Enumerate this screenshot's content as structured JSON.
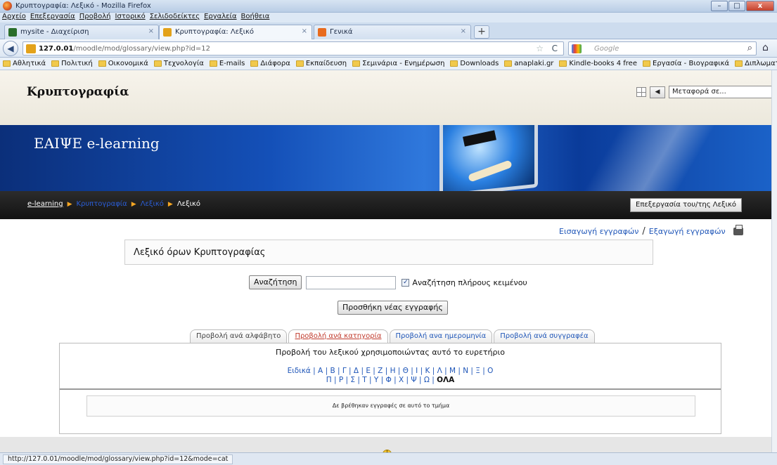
{
  "window": {
    "title": "Κρυπτογραφία: Λεξικό - Mozilla Firefox"
  },
  "menu": [
    "Αρχείο",
    "Επεξεργασία",
    "Προβολή",
    "Ιστορικό",
    "Σελιδοδείκτες",
    "Εργαλεία",
    "Βοήθεια"
  ],
  "tabs": [
    {
      "label": "mysite - Διαχείριση",
      "icon_color": "#2a6e2a"
    },
    {
      "label": "Κρυπτογραφία: Λεξικό",
      "icon_color": "#e3a21a"
    },
    {
      "label": "Γενικά",
      "icon_color": "#e86b1e"
    }
  ],
  "nav": {
    "url_host": "127.0.01",
    "url_path": "/moodle/mod/glossary/view.php?id=12",
    "search_placeholder": "Google"
  },
  "bookmarks": [
    "Αθλητικά",
    "Πολιτική",
    "Οικονομικά",
    "Τεχνολογία",
    "E-mails",
    "Διάφορα",
    "Εκπαίδευση",
    "Σεμινάρια - Ενημέρωση",
    "Downloads",
    "anaplaki.gr",
    "Kindle-books 4 free",
    "Εργασία - Βιογραφικά",
    "Διπλωματική"
  ],
  "page": {
    "course_title": "Κρυπτογραφία",
    "jump_placeholder": "Μεταφορά σε...",
    "banner_title": "ΕΑΙΨΕ e-learning",
    "breadcrumb": {
      "home": "e-learning",
      "course": "Κρυπτογραφία",
      "module": "Λεξικό",
      "current": "Λεξικό"
    },
    "edit_button": "Επεξεργασία του/της Λεξικό",
    "import_link": "Εισαγωγή εγγραφών",
    "export_link": "Εξαγωγή εγγραφών",
    "io_separator": "/",
    "intro": "Λεξικό όρων Κρυπτογραφίας",
    "search_button": "Αναζήτηση",
    "fulltext_label": "Αναζήτηση πλήρους κειμένου",
    "add_entry_button": "Προσθήκη νέας εγγραφής",
    "view_tabs": [
      "Προβολή ανά αλφάβητο",
      "Προβολή ανά κατηγορία",
      "Προβολή ανα ημερομηνία",
      "Προβολή ανά συγγραφέα"
    ],
    "panel_desc": "Προβολή του λεξικού χρησιμοποιώντας αυτό το ευρετήριο",
    "alpha_line1": "Ειδικά | Α | Β | Γ | Δ | Ε | Ζ | Η | Θ | Ι | Κ | Λ | Μ | Ν | Ξ | Ο",
    "alpha_line2": "Π | Ρ | Σ | Τ | Υ | Φ | Χ | Ψ | Ω | ",
    "alpha_all": "ΟΛΑ",
    "empty_message": "Δε βρέθηκαν εγγραφές σε αυτό το τμήμα"
  },
  "status": {
    "url": "http://127.0.01/moodle/mod/glossary/view.php?id=12&mode=cat"
  }
}
